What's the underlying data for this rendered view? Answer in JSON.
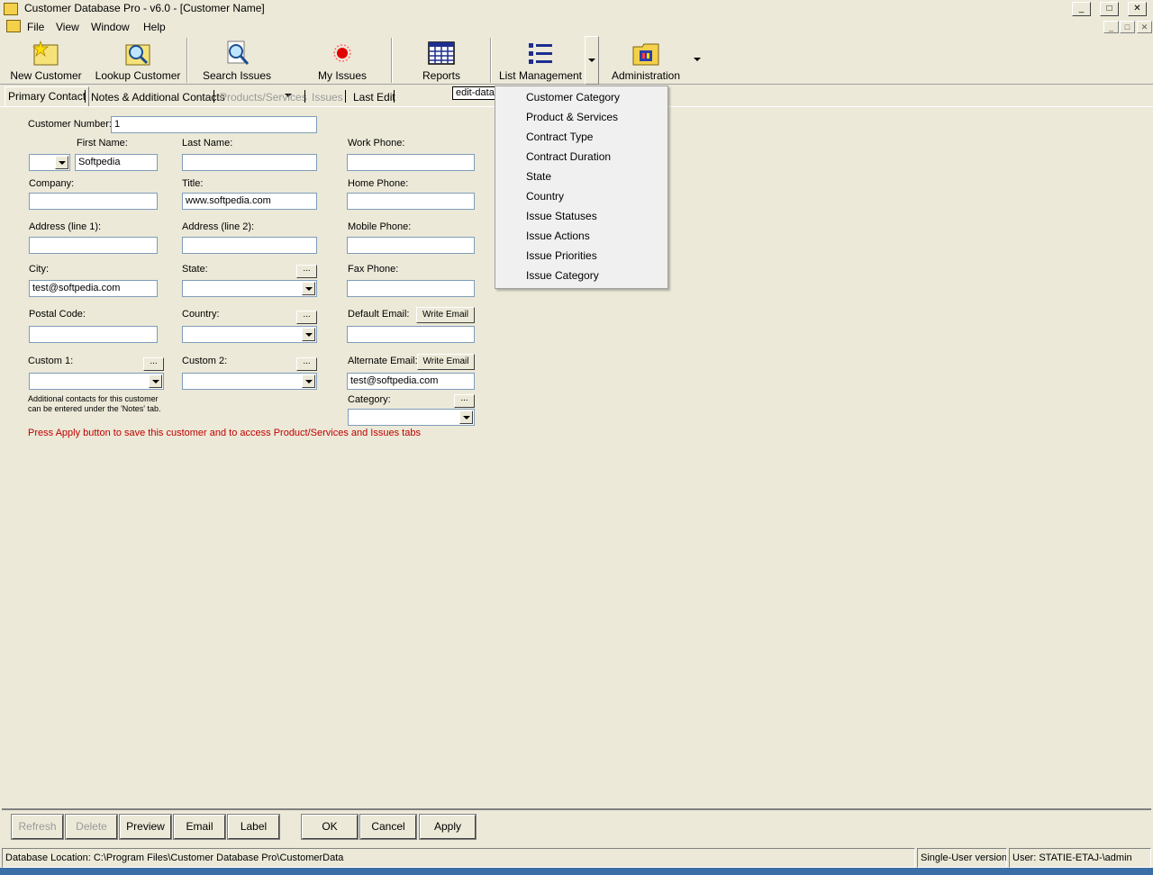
{
  "window": {
    "title": "Customer Database Pro - v6.0 - [Customer Name]",
    "controls": {
      "minimize": "_",
      "maximize": "□",
      "close": "✕"
    }
  },
  "menu": [
    "File",
    "View",
    "Window",
    "Help"
  ],
  "toolbar": {
    "new_customer": "New Customer",
    "lookup_customer": "Lookup Customer",
    "search_issues": "Search Issues",
    "my_issues": "My Issues",
    "reports": "Reports",
    "list_management": "List Management",
    "administration": "Administration"
  },
  "tabs": [
    "Primary Contact",
    "Notes & Additional Contacts",
    "Products/Services",
    "Issues",
    "Last Edit"
  ],
  "tooltip": "edit-data",
  "form": {
    "customer_number_label": "Customer Number:",
    "customer_number_value": "1",
    "first_name_label": "First Name:",
    "first_name_value": "Softpedia",
    "last_name_label": "Last Name:",
    "work_phone_label": "Work Phone:",
    "company_label": "Company:",
    "title_label": "Title:",
    "title_value": "www.softpedia.com",
    "home_phone_label": "Home Phone:",
    "address1_label": "Address (line 1):",
    "address2_label": "Address (line 2):",
    "mobile_phone_label": "Mobile Phone:",
    "city_label": "City:",
    "city_value": "test@softpedia.com",
    "state_label": "State:",
    "fax_phone_label": "Fax Phone:",
    "postal_code_label": "Postal Code:",
    "country_label": "Country:",
    "default_email_label": "Default Email:",
    "write_email": "Write Email",
    "custom1_label": "Custom 1:",
    "custom2_label": "Custom 2:",
    "alternate_email_label": "Alternate Email:",
    "alternate_email_value": "test@softpedia.com",
    "category_label": "Category:",
    "dots": "...",
    "hint_line1": "Additional contacts for this customer",
    "hint_line2": "can be entered under the 'Notes' tab.",
    "apply_notice": "Press Apply button to save this customer and to access Product/Services and Issues tabs"
  },
  "list_menu": [
    "Customer Category",
    "Product & Services",
    "Contract Type",
    "Contract Duration",
    "State",
    "Country",
    "Issue Statuses",
    "Issue Actions",
    "Issue Priorities",
    "Issue Category"
  ],
  "buttons": {
    "refresh": "Refresh",
    "delete": "Delete",
    "preview": "Preview",
    "email": "Email",
    "label": "Label",
    "ok": "OK",
    "cancel": "Cancel",
    "apply": "Apply"
  },
  "status": {
    "db_location": "Database Location: C:\\Program Files\\Customer Database Pro\\CustomerData",
    "version": "Single-User version",
    "user": "User: STATIE-ETAJ-\\admin"
  },
  "colors": {
    "notice": "#c00000",
    "background": "#ece9d8",
    "field_border": "#7f9db9"
  }
}
